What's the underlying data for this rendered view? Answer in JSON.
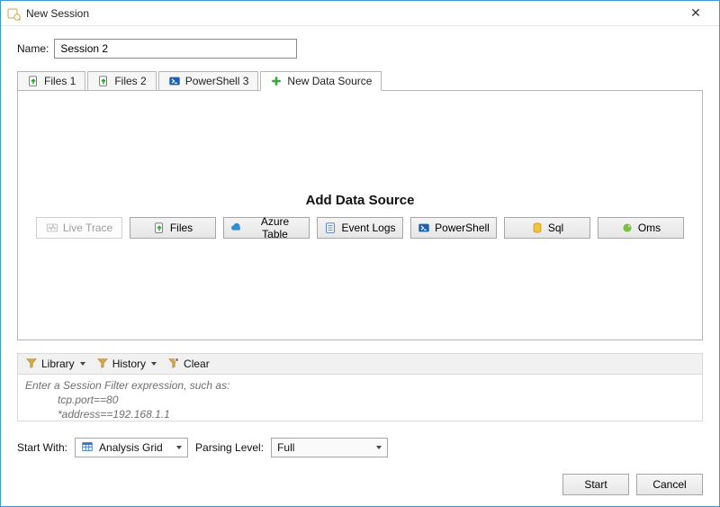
{
  "window": {
    "title": "New Session"
  },
  "name": {
    "label": "Name:",
    "value": "Session 2"
  },
  "tabs": [
    {
      "label": "Files 1",
      "icon": "files-up-icon"
    },
    {
      "label": "Files 2",
      "icon": "files-up-icon"
    },
    {
      "label": "PowerShell 3",
      "icon": "powershell-icon"
    },
    {
      "label": "New Data Source",
      "icon": "plus-icon",
      "active": true
    }
  ],
  "addDataSource": {
    "title": "Add Data Source",
    "buttons": [
      {
        "label": "Live Trace",
        "icon": "live-trace-icon",
        "disabled": true
      },
      {
        "label": "Files",
        "icon": "files-up-icon"
      },
      {
        "label": "Azure Table",
        "icon": "azure-cloud-icon"
      },
      {
        "label": "Event Logs",
        "icon": "event-logs-icon"
      },
      {
        "label": "PowerShell",
        "icon": "powershell-icon"
      },
      {
        "label": "Sql",
        "icon": "sql-icon"
      },
      {
        "label": "Oms",
        "icon": "oms-icon"
      }
    ]
  },
  "filterBar": {
    "library": "Library",
    "history": "History",
    "clear": "Clear"
  },
  "filterPlaceholder": {
    "line1": "Enter a Session Filter expression, such as:",
    "line2": "tcp.port==80",
    "line3": "*address==192.168.1.1"
  },
  "startWith": {
    "label": "Start With:",
    "value": "Analysis Grid"
  },
  "parsingLevel": {
    "label": "Parsing Level:",
    "value": "Full"
  },
  "buttons": {
    "start": "Start",
    "cancel": "Cancel"
  }
}
